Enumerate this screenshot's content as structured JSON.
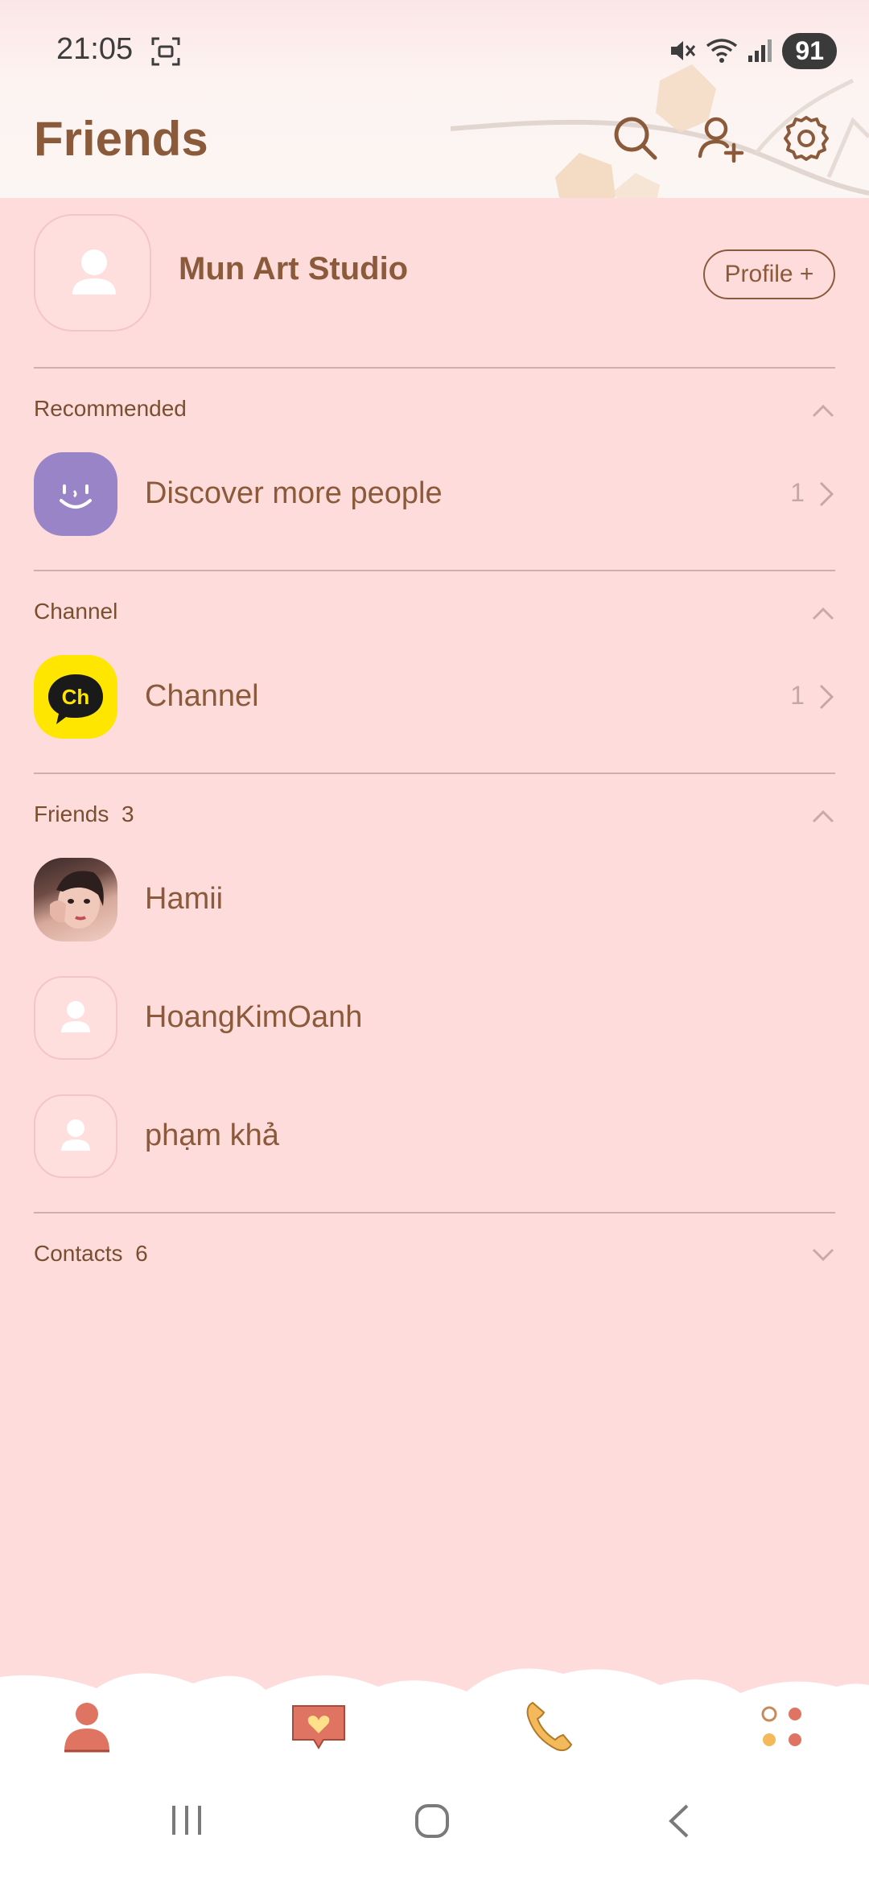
{
  "status_bar": {
    "time": "21:05",
    "battery": "91"
  },
  "header": {
    "title": "Friends"
  },
  "profile": {
    "name": "Mun Art Studio",
    "button_label": "Profile +"
  },
  "sections": {
    "recommended": {
      "label": "Recommended",
      "item": {
        "name": "Discover more people",
        "count": "1"
      }
    },
    "channel": {
      "label": "Channel",
      "item": {
        "name": "Channel",
        "count": "1"
      }
    },
    "friends": {
      "label": "Friends",
      "count": "3",
      "items": [
        {
          "name": "Hamii"
        },
        {
          "name": "HoangKimOanh"
        },
        {
          "name": "phạm khả"
        }
      ]
    },
    "contacts": {
      "label": "Contacts",
      "count": "6"
    }
  },
  "colors": {
    "accent": "#8a5a3a",
    "background": "#fedcdc",
    "channel_yellow": "#ffe600",
    "discover_purple": "#9a84c8"
  }
}
